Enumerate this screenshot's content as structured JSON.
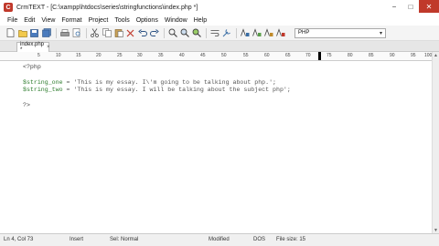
{
  "window": {
    "title": "CrmTEXT - [C:\\xampp\\htdocs\\series\\stringfunctions\\index.php *]",
    "app_icon": "C",
    "minimize": "−",
    "maximize": "□",
    "close": "✕"
  },
  "menu": [
    "File",
    "Edit",
    "View",
    "Format",
    "Project",
    "Tools",
    "Options",
    "Window",
    "Help"
  ],
  "toolbar": {
    "language": "PHP",
    "dropdown_arrow": "▾"
  },
  "tab": {
    "label": "index.php *",
    "close": "×"
  },
  "ruler": {
    "marks": [
      "5",
      "10",
      "15",
      "20",
      "25",
      "30",
      "35",
      "40",
      "45",
      "50",
      "55",
      "60",
      "65",
      "70",
      "75",
      "80",
      "85",
      "90",
      "95",
      "100"
    ]
  },
  "editor": {
    "line1": "<?php",
    "line2": "",
    "line3_var": "$string_one",
    "line3_rest": " = 'This is my essay. I\\'m going to be talking about php.';",
    "line4_var": "$string_two",
    "line4_rest": " = 'This is my essay. I will be talking about the subject php';",
    "line5": "",
    "line6": "?>"
  },
  "status": {
    "position": "Ln 4, Col 73",
    "mode": "Insert",
    "selection": "Sel: Normal",
    "modified": "Modified",
    "line_endings": "DOS",
    "file_size": "File size: 15"
  }
}
